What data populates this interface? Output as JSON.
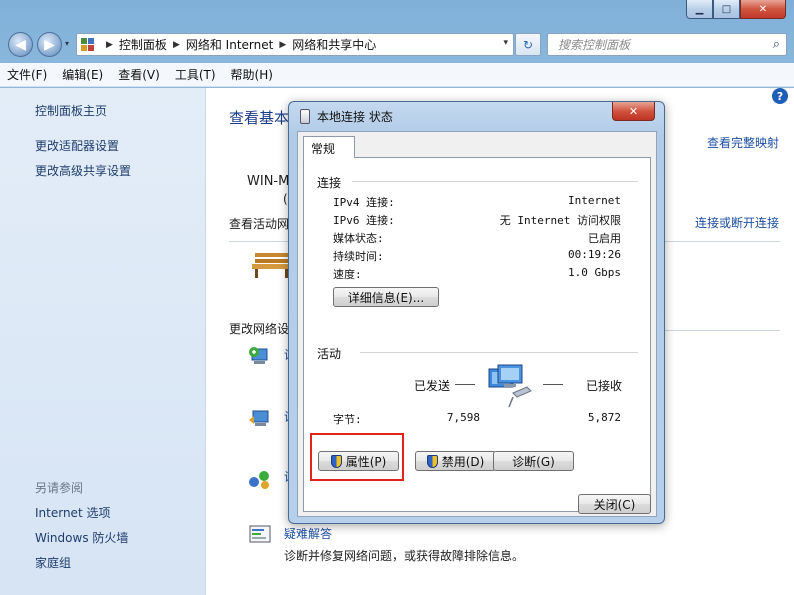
{
  "window": {
    "caption_buttons": {
      "minimize": "▁",
      "maximize": "□",
      "close": "✕"
    }
  },
  "nav": {
    "back_icon": "◀",
    "forward_icon": "▶",
    "history_icon": "▾",
    "breadcrumbs": [
      "控制面板",
      "网络和 Internet",
      "网络和共享中心"
    ],
    "breadcrumb_separator": "▶",
    "dropdown_icon": "▾",
    "refresh_icon": "↻",
    "search_placeholder": "搜索控制面板",
    "search_icon": "⌕"
  },
  "menu": [
    "文件(F)",
    "编辑(E)",
    "查看(V)",
    "工具(T)",
    "帮助(H)"
  ],
  "left_pane": {
    "links": [
      "控制面板主页",
      "更改适配器设置",
      "更改高级共享设置"
    ],
    "see_also_title": "另请参阅",
    "see_also": [
      "Internet 选项",
      "Windows 防火墙",
      "家庭组"
    ]
  },
  "main": {
    "help_icon": "?",
    "title": "查看基本",
    "view_full_map": "查看完整映射",
    "computer_name": "WIN-M",
    "computer_sub": "(I",
    "active_networks": "查看活动网",
    "connect_disconnect": "连接或断开连接",
    "change_settings": "更改网络设",
    "item_l1": "设",
    "item_l2": "设",
    "item_l3": "设",
    "troubleshoot": "疑难解答",
    "troubleshoot_desc": "诊断并修复网络问题，或获得故障排除信息。"
  },
  "dialog": {
    "title": "本地连接 状态",
    "close_icon": "✕",
    "tab": "常规",
    "connection": {
      "section": "连接",
      "rows": [
        {
          "label": "IPv4 连接:",
          "value": "Internet"
        },
        {
          "label": "IPv6 连接:",
          "value": "无 Internet 访问权限"
        },
        {
          "label": "媒体状态:",
          "value": "已启用"
        },
        {
          "label": "持续时间:",
          "value": "00:19:26"
        },
        {
          "label": "速度:",
          "value": "1.0 Gbps"
        }
      ],
      "details_button": "详细信息(E)..."
    },
    "activity": {
      "section": "活动",
      "sent_label": "已发送",
      "received_label": "已接收",
      "bytes_label": "字节:",
      "bytes_sent": "7,598",
      "bytes_received": "5,872"
    },
    "buttons": {
      "properties": "属性(P)",
      "disable": "禁用(D)",
      "diagnose": "诊断(G)",
      "close": "关闭(C)"
    }
  },
  "colors": {
    "frame": "#a5c9e6",
    "link": "#1c4fa4",
    "title": "#1b3d8a",
    "highlight": "#e0241b"
  }
}
